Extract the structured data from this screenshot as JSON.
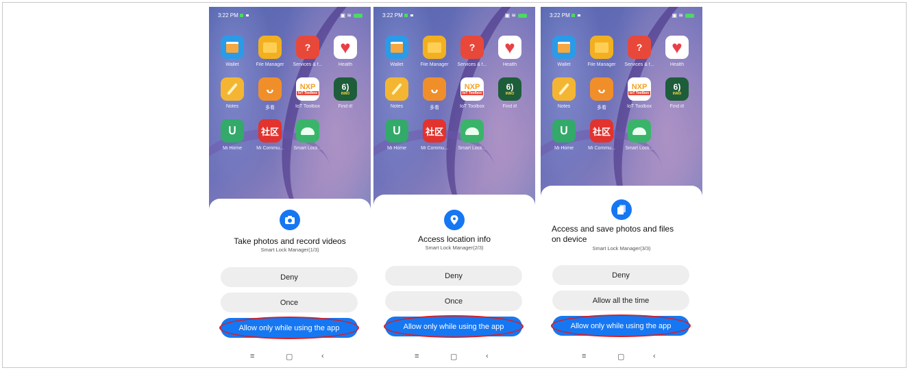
{
  "screens": [
    {
      "time": "3:22 PM",
      "permission": {
        "title": "Take photos and record videos",
        "subtitle": "Smart Lock Manager(1/3)",
        "icon": "camera-icon",
        "buttons": [
          "Deny",
          "Once",
          "Allow only while using the app"
        ]
      }
    },
    {
      "time": "3:22 PM",
      "permission": {
        "title": "Access location info",
        "subtitle": "Smart Lock Manager(2/3)",
        "icon": "location-pin-icon",
        "buttons": [
          "Deny",
          "Once",
          "Allow only while using the app"
        ]
      }
    },
    {
      "time": "3:22 PM",
      "permission": {
        "title": "Access and save photos and files on device",
        "subtitle": "Smart Lock Manager(3/3)",
        "icon": "files-icon",
        "buttons": [
          "Deny",
          "Allow all the time",
          "Allow only while using the app"
        ]
      }
    }
  ],
  "apps": [
    {
      "label": "Wallet",
      "icon": "wallet-icon"
    },
    {
      "label": "File Manager",
      "icon": "file-manager-icon"
    },
    {
      "label": "Services & f...",
      "icon": "services-icon",
      "glyph": "?"
    },
    {
      "label": "Health",
      "icon": "health-icon"
    },
    {
      "label": "Notes",
      "icon": "notes-icon"
    },
    {
      "label": "多看",
      "icon": "duokan-icon",
      "glyph": "ᴗ"
    },
    {
      "label": "IoT Toolbox",
      "icon": "iot-toolbox-icon",
      "glyph": "NXP",
      "badge": "IoT Toolbox"
    },
    {
      "label": "Find it!",
      "icon": "find-it-icon",
      "glyph": "6)",
      "badge": "INNO"
    },
    {
      "label": "Mi Home",
      "icon": "mi-home-icon",
      "glyph": "ᑌ"
    },
    {
      "label": "Mi Commu...",
      "icon": "mi-community-icon",
      "glyph": "社区"
    },
    {
      "label": "Smart Lock...",
      "icon": "android-app-icon"
    }
  ],
  "navbar": {
    "menu": "≡",
    "home": "▢",
    "back": "‹"
  },
  "colors": {
    "accent": "#1677f2",
    "highlight_ring": "#d4202a"
  }
}
